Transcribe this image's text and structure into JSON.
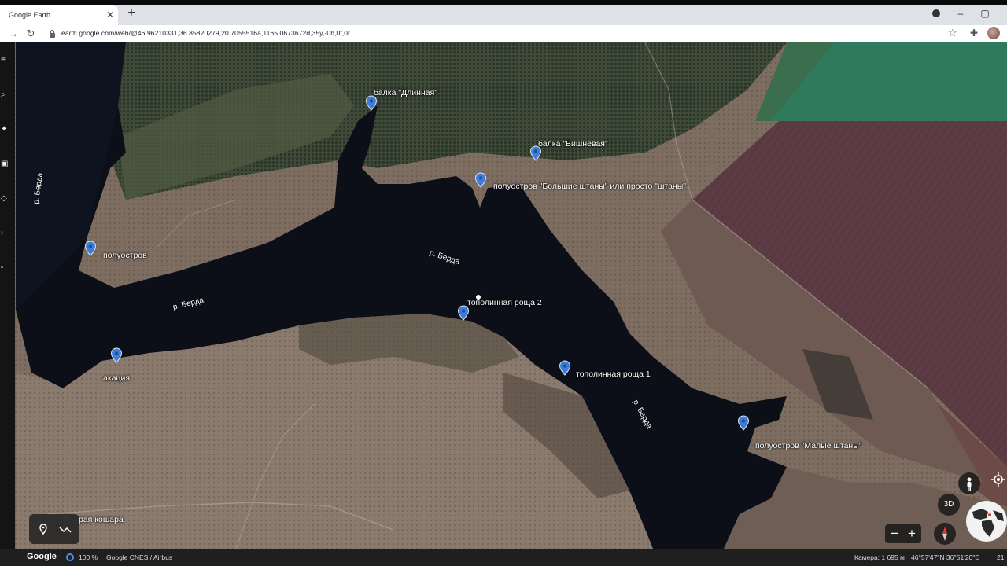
{
  "browser": {
    "tab_title": "Google Earth",
    "tab_close": "✕",
    "new_tab": "+",
    "url": "earth.google.com/web/@46.96210331,36.85820279,20.7055516a,1165.0673672d,35y,-0h,0t,0r",
    "minimize": "–",
    "restore": "▢"
  },
  "map": {
    "placemarks": [
      {
        "label": "балка \"Длинная\""
      },
      {
        "label": "балка \"Вишневая\""
      },
      {
        "label": "полуостров \"Большие штаны\" или просто \"штаны\""
      },
      {
        "label": "полуостров"
      },
      {
        "label": "тополинная роща 2"
      },
      {
        "label": "акация"
      },
      {
        "label": "тополинная роща 1"
      },
      {
        "label": "полуостров \"Малые штаны\""
      },
      {
        "label": "рая кошара"
      }
    ],
    "river_labels": [
      "р. Берда",
      "р. Берда",
      "р. Берда",
      "р. Берда"
    ]
  },
  "controls": {
    "three_d_label": "3D",
    "zoom_out": "−",
    "zoom_in": "+"
  },
  "status": {
    "brand": "Google",
    "zoom_percent": "100 %",
    "attribution": "Google  CNES / Airbus",
    "camera": "Камера: 1 695 м",
    "coords": "46°57'47\"N 36°51'20\"E",
    "extra": "21"
  },
  "colors": {
    "water": "#0c0f18",
    "land": "#7d6c60",
    "field_purple": "#5d3b45",
    "field_green": "#2f7a5c",
    "pin_blue": "#3b7dd8"
  }
}
